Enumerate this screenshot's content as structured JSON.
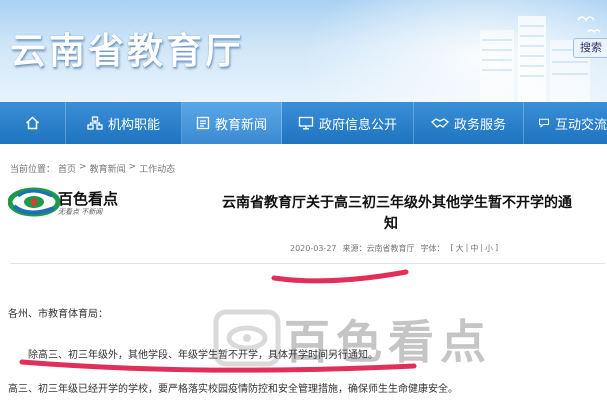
{
  "header": {
    "site_title": "云南省教育厅",
    "search_label": "搜索",
    "brand_color": "#2a7fca"
  },
  "nav": {
    "items": [
      {
        "label": "",
        "icon": "home-icon"
      },
      {
        "label": "机构职能",
        "icon": "sitemap-icon"
      },
      {
        "label": "教育新闻",
        "icon": "news-icon",
        "active": true
      },
      {
        "label": "政府信息公开",
        "icon": "monitor-icon"
      },
      {
        "label": "政务服务",
        "icon": "handshake-icon"
      },
      {
        "label": "互动交流",
        "icon": "chat-icon"
      }
    ]
  },
  "breadcrumb": {
    "prefix": "当前位置：",
    "home": "首页",
    "sep1": ">",
    "section": "教育新闻",
    "sep2": ">",
    "current": "工作动态"
  },
  "logo": {
    "name": "百色看点",
    "slogan": "无看点 不新闻"
  },
  "article": {
    "title_line1": "云南省教育厅关于高三初三年级外其他学生暂不开学的通",
    "title_line2": "知",
    "date": "2020-03-27",
    "source": "来源：云南省教育厅",
    "font_label": "字体：",
    "size_sep_open": "[",
    "size_large": "大",
    "size_medium": "中",
    "size_small": "小",
    "size_sep_close": "]",
    "salutation": "各州、市教育体育局：",
    "paragraph1": "除高三、初三年级外，其他学段、年级学生暂不开学，具体开学时间另行通知。",
    "paragraph2": "高三、初三年级已经开学的学校，要严格落实校园疫情防控和安全管理措施，确保师生生命健康安全。"
  },
  "watermark": {
    "text": "百色看点"
  },
  "colors": {
    "annotation": "#e0305a",
    "nav_bg": "#2677c4"
  }
}
